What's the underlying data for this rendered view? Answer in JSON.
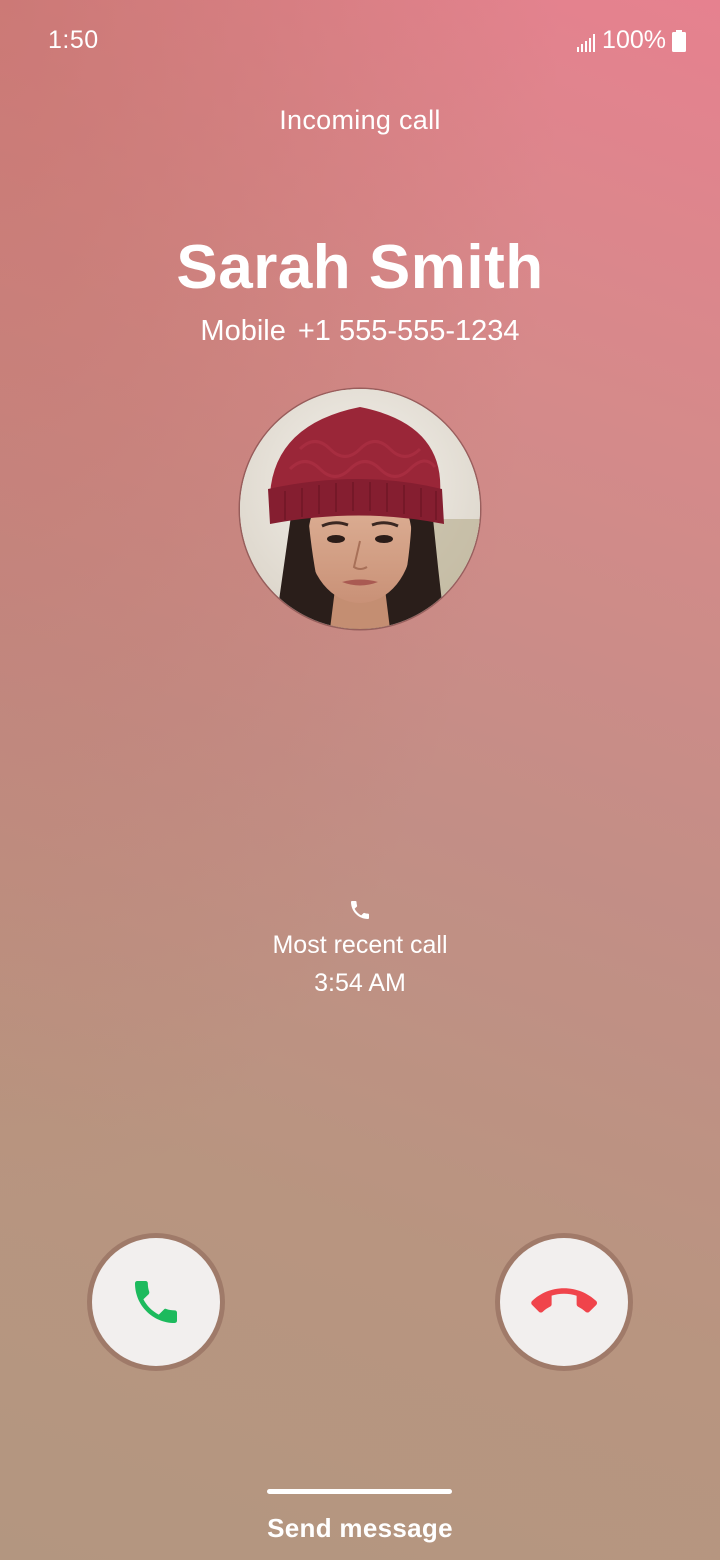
{
  "status_bar": {
    "time": "1:50",
    "battery": "100%",
    "signal_icon": "signal-icon",
    "battery_icon": "battery-icon"
  },
  "call": {
    "status_label": "Incoming call",
    "caller_name": "Sarah Smith",
    "number_type": "Mobile",
    "phone_number": "+1 555-555-1234",
    "avatar_icon": "contact-photo"
  },
  "recent": {
    "icon": "phone-icon",
    "label": "Most recent call",
    "time": "3:54 AM"
  },
  "actions": {
    "accept_icon": "phone-accept-icon",
    "accept_color": "#1dba5d",
    "decline_icon": "phone-hangup-icon",
    "decline_color": "#f0444b",
    "send_message_label": "Send message"
  },
  "colors": {
    "background_top": "#e6818f",
    "background_bottom": "#b39680",
    "button_fill": "#f2efee"
  }
}
